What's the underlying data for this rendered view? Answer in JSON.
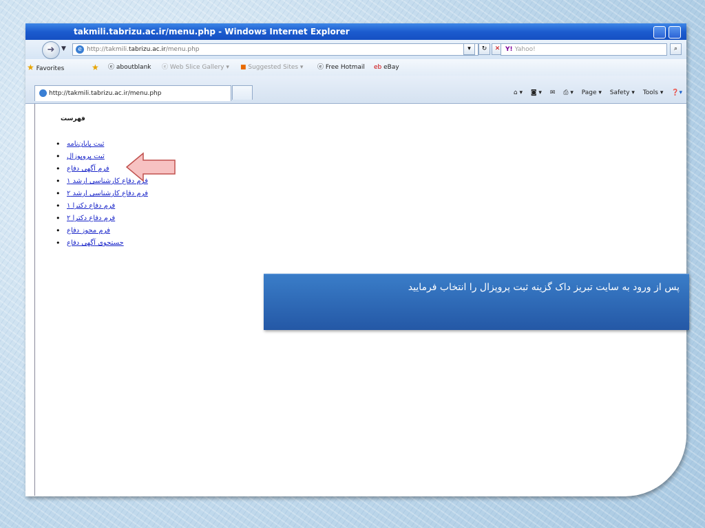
{
  "window": {
    "title": "takmili.tabrizu.ac.ir/menu.php - Windows Internet Explorer"
  },
  "address_bar": {
    "url_prefix": "http://takmili.",
    "url_domain": "tabrizu.ac.ir",
    "url_suffix": "/menu.php",
    "search_placeholder": "Yahoo!",
    "search_logo": "Y!"
  },
  "favorites_bar": {
    "favorites_label": "Favorites",
    "items": [
      "aboutblank",
      "Web Slice Gallery ▾",
      "Suggested Sites ▾",
      "Free Hotmail",
      "eBay"
    ]
  },
  "tab": {
    "label": "http://takmili.tabrizu.ac.ir/menu.php"
  },
  "command_bar": {
    "page": "Page ▾",
    "safety": "Safety ▾",
    "tools": "Tools ▾"
  },
  "page": {
    "heading": "فهرست",
    "links": [
      "ثبت پایان‌نامه",
      "ثبت پروپوزال",
      "فرم آگهی دفاع",
      "فرم دفاع کارشناسی ارشد ۱",
      "فرم دفاع کارشناسی ارشد ۲",
      "فرم دفاع دکترا ۱",
      "فرم دفاع دکترا ۲",
      "فرم مجوز دفاع",
      "جستجوی آگهی دفاع"
    ]
  },
  "callout": {
    "text": "پس از ورود به سایت تبریز داک گزینه ثبت پروپزال را انتخاب فرمایید"
  },
  "colors": {
    "link": "#1a26c9",
    "callout_bg": "#2f6bb8",
    "arrow_fill": "#f7c2c2",
    "arrow_stroke": "#c0504d"
  }
}
